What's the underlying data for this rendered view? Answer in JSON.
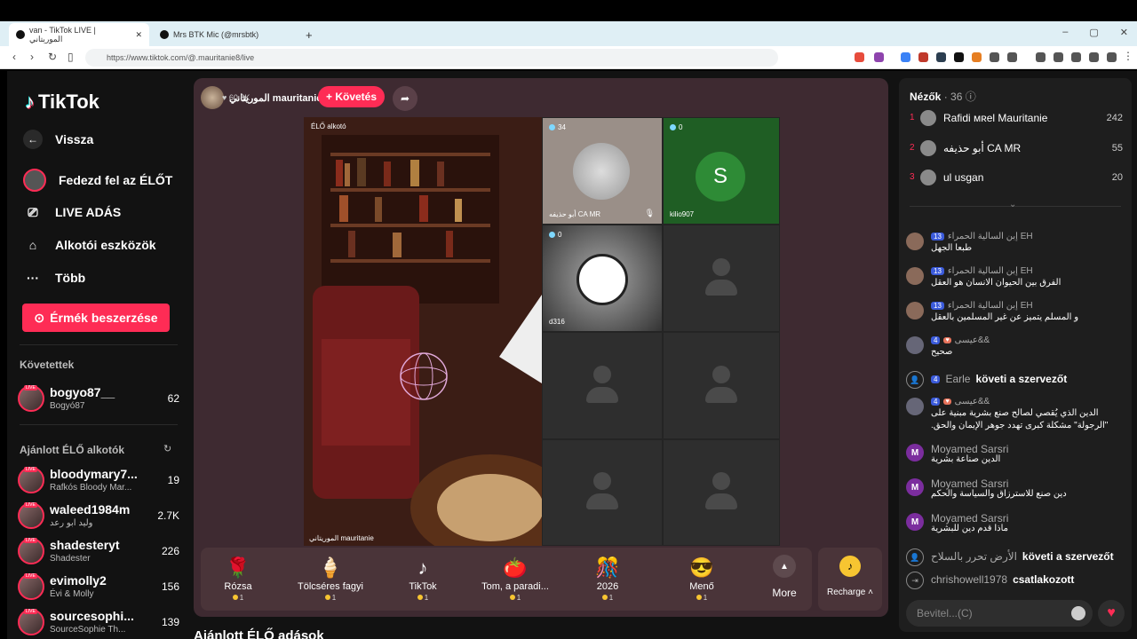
{
  "browser": {
    "tabs": [
      {
        "label": "van - TikTok LIVE | الموريتاني"
      },
      {
        "label": "Mrs BTK Mic (@mrsbtk)"
      }
    ],
    "new_tab": "+",
    "url": "https://www.tiktok.com/@.mauritanie8/live"
  },
  "sidebar": {
    "logo": "TikTok",
    "back": "Vissza",
    "nav": [
      "Fedezd fel az ÉLŐT",
      "LIVE ADÁS",
      "Alkotói eszközök",
      "Több"
    ],
    "coin_button": "Érmék beszerzése",
    "following_title": "Követettek",
    "following": [
      {
        "name": "bogyo87__",
        "sub": "Bogyó87",
        "count": "62"
      }
    ],
    "recommended_title": "Ajánlott ÉLŐ alkotók",
    "recommended": [
      {
        "name": "bloodymary7...",
        "sub": "Rafkós Bloody Mar...",
        "count": "19"
      },
      {
        "name": "waleed1984m",
        "sub": "وليد ابو رعد",
        "count": "2.7K"
      },
      {
        "name": "shadesteryt",
        "sub": "Shadester",
        "count": "226"
      },
      {
        "name": "evimolly2",
        "sub": "Évi & Molly",
        "count": "156"
      },
      {
        "name": "sourcesophi...",
        "sub": "SourceSophie Th...",
        "count": "139"
      }
    ]
  },
  "live": {
    "host_name": "الموريتاني mauritanie",
    "host_likes": "60.8K",
    "follow_label": "+ Követés",
    "video_tag": "ÉLŐ alkotó",
    "video_caption": "الموريتاني mauritanie",
    "guests": [
      {
        "count": "34",
        "name": "أبو حذيفه CA MR"
      },
      {
        "count": "0",
        "name": "kilio907",
        "initial": "S"
      },
      {
        "count": "0",
        "name": "d316"
      }
    ],
    "gifts": [
      {
        "name": "Rózsa",
        "price": "1",
        "icon": "🌹"
      },
      {
        "name": "Tölcséres fagyi",
        "price": "1",
        "icon": "🍦"
      },
      {
        "name": "TikTok",
        "price": "1",
        "icon": "♪"
      },
      {
        "name": "Tom, a paradi...",
        "price": "1",
        "icon": "🍅"
      },
      {
        "name": "2026",
        "price": "1",
        "icon": "🎊"
      },
      {
        "name": "Menő",
        "price": "1",
        "icon": "😎"
      }
    ],
    "more_label": "More",
    "recharge_label": "Recharge",
    "below_title": "Ajánlott ÉLŐ adások"
  },
  "chat": {
    "viewers_title": "Nézők",
    "viewers_count": "· 36",
    "ranking": [
      {
        "rank": "1",
        "name": "Rafidi ᴍʀel Mauritanie",
        "score": "242"
      },
      {
        "rank": "2",
        "name": "أبو حذيفه CA MR",
        "score": "55"
      },
      {
        "rank": "3",
        "name": "ul usgan",
        "score": "20"
      }
    ],
    "messages": [
      {
        "user": "إبن السالية الحمراء EH",
        "level": "13",
        "text": "طبعا الجهل"
      },
      {
        "user": "إبن السالية الحمراء EH",
        "level": "13",
        "text": "الفرق بين الحيوان الانسان هو العقل"
      },
      {
        "user": "إبن السالية الحمراء EH",
        "level": "13",
        "text": "و المسلم يتميز عن غير المسلمين بالعقل"
      },
      {
        "user": "عيسى&&",
        "level": "4",
        "text": "صحيح"
      },
      {
        "user": "Earle",
        "level": "4",
        "action": "követi a szervezőt"
      },
      {
        "user": "عيسى&&",
        "level": "4",
        "text": "الدين الذي يُقصي لصالح صنع بشرية مبنية على",
        "text2": "\"الرجولة\" مشكلة كبرى تهدد جوهر الإيمان والحق."
      },
      {
        "user": "Moyamed Sarsri",
        "text": "الدين صناعة بشرية"
      },
      {
        "user": "Moyamed Sarsri",
        "text": "دين صنع للاسترزاق والسياسة والحكم"
      },
      {
        "user": "Moyamed Sarsri",
        "text": "ماذا قدم دين للبشرية"
      },
      {
        "user": "الأرض تحرر بالسلاح",
        "action": "követi a szervezőt"
      },
      {
        "user": "chrishowell1978",
        "action": "csatlakozott"
      }
    ],
    "input_placeholder": "Bevitel...(C)"
  }
}
